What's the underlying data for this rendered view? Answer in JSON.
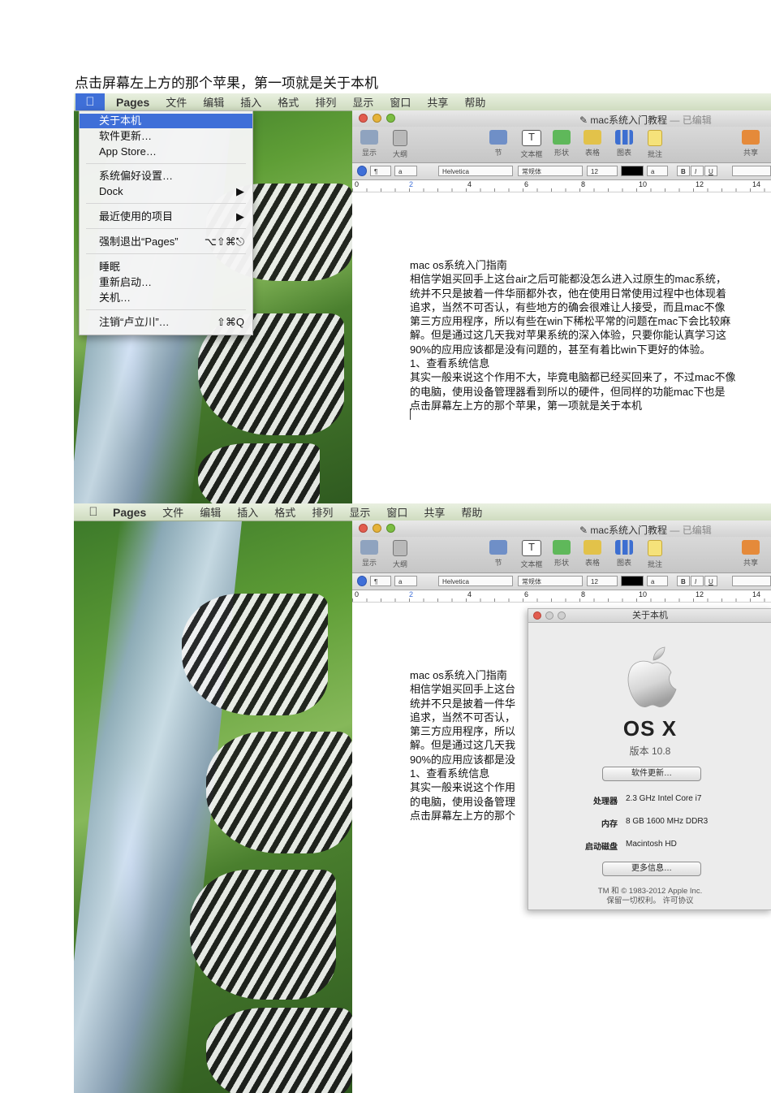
{
  "caption": "点击屏幕左上方的那个苹果，第一项就是关于本机",
  "menubar": {
    "app": "Pages",
    "items": [
      "文件",
      "编辑",
      "插入",
      "格式",
      "排列",
      "显示",
      "窗口",
      "共享",
      "帮助"
    ]
  },
  "apple_menu": {
    "about": "关于本机",
    "software_update": "软件更新…",
    "app_store": "App Store…",
    "system_prefs": "系统偏好设置…",
    "dock": "Dock",
    "recent_items": "最近使用的项目",
    "force_quit": "强制退出“Pages”",
    "force_quit_shortcut": "⌥⇧⌘⎋",
    "sleep": "睡眠",
    "restart": "重新启动…",
    "shutdown": "关机…",
    "logout": "注销“卢立川”…",
    "logout_shortcut": "⇧⌘Q",
    "submenu_arrow": "▶"
  },
  "window": {
    "title": "mac系统入门教程",
    "title_status": "— 已编辑",
    "toolbar": {
      "show": "显示",
      "outline": "大纲",
      "section": "节",
      "textbox": "文本框",
      "shapes": "形状",
      "table": "表格",
      "chart": "图表",
      "comment": "批注",
      "share": "共享"
    },
    "format": {
      "font": "Helvetica",
      "style": "常规体",
      "size": "12",
      "bold": "B",
      "italic": "I",
      "underline": "U",
      "para": "¶",
      "char": "a"
    },
    "ruler": [
      "0",
      "2",
      "4",
      "6",
      "8",
      "10",
      "12",
      "14"
    ]
  },
  "doc_lines": [
    "mac os系统入门指南",
    "相信学姐买回手上这台air之后可能都没怎么进入过原生的mac系统，",
    "统并不只是披着一件华丽都外衣，他在使用日常使用过程中也体现着",
    "追求，当然不可否认，有些地方的确会很难让人接受，而且mac不像",
    "第三方应用程序，所以有些在win下稀松平常的问题在mac下会比较麻",
    "解。但是通过这几天我对苹果系统的深入体验，只要你能认真学习这",
    "90%的应用应该都是没有问题的，甚至有着比win下更好的体验。",
    "1、查看系统信息",
    "其实一般来说这个作用不大，毕竟电脑都已经买回来了，不过mac不像",
    "的电脑，使用设备管理器看到所以的硬件，但同样的功能mac下也是",
    "点击屏幕左上方的那个苹果，第一项就是关于本机"
  ],
  "doc_lines_clipped": [
    "mac os系统入门指南",
    "相信学姐买回手上这台",
    "统并不只是披着一件华",
    "追求，当然不可否认，",
    "第三方应用程序，所以",
    "解。但是通过这几天我",
    "90%的应用应该都是没",
    "1、查看系统信息",
    "其实一般来说这个作用",
    "的电脑，使用设备管理",
    "点击屏幕左上方的那个"
  ],
  "about": {
    "title": "关于本机",
    "os_name": "OS X",
    "version": "版本 10.8",
    "update_button": "软件更新…",
    "processor_label": "处理器",
    "processor": "2.3 GHz Intel Core i7",
    "memory_label": "内存",
    "memory": "8 GB 1600 MHz DDR3",
    "disk_label": "启动磁盘",
    "disk": "Macintosh HD",
    "more_button": "更多信息…",
    "copyright": "TM 和 © 1983-2012 Apple Inc.",
    "rights": "保留一切权利。 许可协议"
  }
}
